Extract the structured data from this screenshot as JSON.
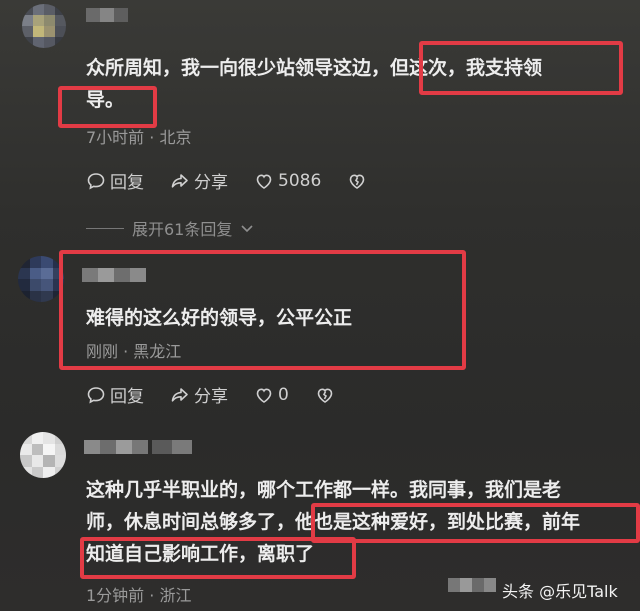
{
  "comments": [
    {
      "text": [
        "众所周知，我一向很少站领导这边，但这次，我支持领",
        "导。"
      ],
      "meta": "7小时前 · 北京",
      "reply_label": "回复",
      "share_label": "分享",
      "like_count": "5086"
    },
    {
      "text": [
        "难得的这么好的领导，公平公正"
      ],
      "meta": "刚刚 · 黑龙江",
      "reply_label": "回复",
      "share_label": "分享",
      "like_count": "0"
    },
    {
      "text": [
        "这种几乎半职业的，哪个工作都一样。我同事，我们是老",
        "师，休息时间总够多了，他也是这种爱好，到处比赛，前年",
        "知道自己影响工作，离职了"
      ],
      "meta": "1分钟前 · 浙江"
    }
  ],
  "expand_replies": "展开61条回复",
  "watermark": "头条 @乐见Talk",
  "colors": {
    "highlight": "#e23b45",
    "text": "#ededed",
    "meta": "#9a9a9a"
  },
  "icons": [
    "comment-bubble-icon",
    "share-arrow-icon",
    "heart-icon",
    "broken-heart-icon",
    "chevron-down-icon"
  ]
}
